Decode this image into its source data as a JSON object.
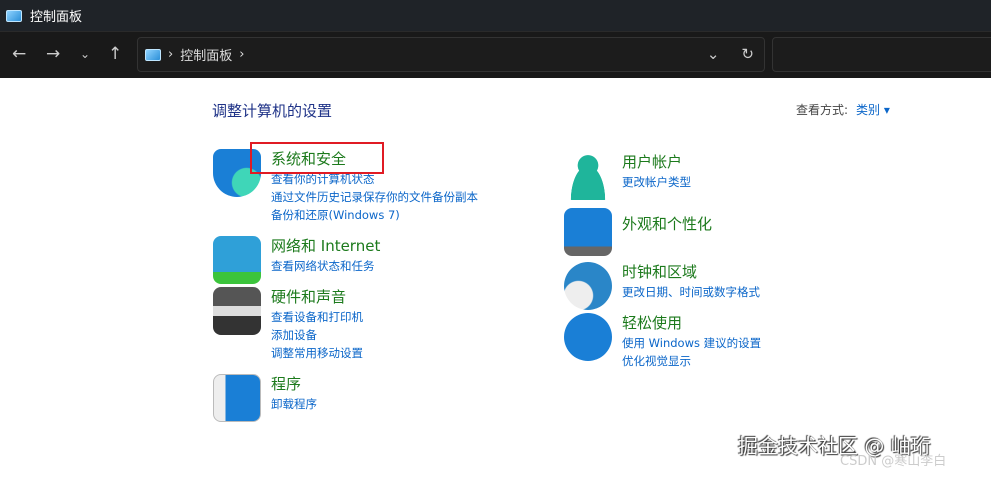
{
  "window": {
    "title": "控制面板"
  },
  "address": {
    "crumb": "控制面板"
  },
  "main": {
    "heading": "调整计算机的设置",
    "view_by_label": "查看方式:",
    "view_by_value": "类别 ▾"
  },
  "categories": [
    {
      "title": "系统和安全",
      "links": [
        "查看你的计算机状态",
        "通过文件历史记录保存你的文件备份副本",
        "备份和还原(Windows 7)"
      ]
    },
    {
      "title": "网络和 Internet",
      "links": [
        "查看网络状态和任务"
      ]
    },
    {
      "title": "硬件和声音",
      "links": [
        "查看设备和打印机",
        "添加设备",
        "调整常用移动设置"
      ]
    },
    {
      "title": "程序",
      "links": [
        "卸载程序"
      ]
    },
    {
      "title": "用户帐户",
      "links": [
        "更改帐户类型"
      ]
    },
    {
      "title": "外观和个性化",
      "links": []
    },
    {
      "title": "时钟和区域",
      "links": [
        "更改日期、时间或数字格式"
      ]
    },
    {
      "title": "轻松使用",
      "links": [
        "使用 Windows 建议的设置",
        "优化视觉显示"
      ]
    }
  ],
  "watermarks": [
    "掘金技术社区 @ 岫珩",
    "CSDN @寒山李白"
  ]
}
